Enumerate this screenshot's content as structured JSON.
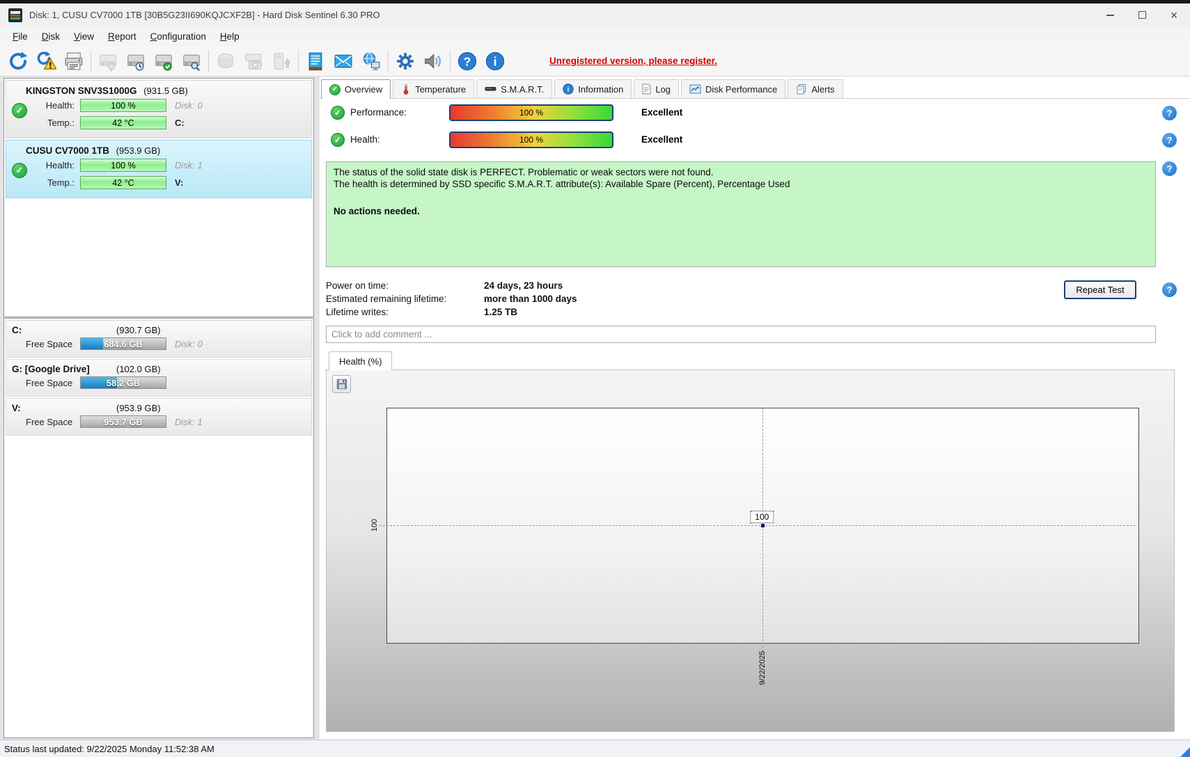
{
  "window": {
    "title": "Disk: 1, CUSU CV7000 1TB [30B5G23II690KQJCXF2B]  -  Hard Disk Sentinel 6.30 PRO",
    "control_icons": [
      "minimize-icon",
      "maximize-icon",
      "close-icon"
    ]
  },
  "menu": {
    "items": [
      "File",
      "Disk",
      "View",
      "Report",
      "Configuration",
      "Help"
    ]
  },
  "toolbar": {
    "icon_names": [
      "refresh-icon",
      "refresh-warning-icon",
      "report-printer-icon",
      "disk-connect-icon",
      "disk-clock-icon",
      "disk-check-icon",
      "disk-search-icon",
      "disk-generic-icon",
      "disk-camera-icon",
      "disk-eject-icon",
      "notes-icon",
      "email-icon",
      "network-icon",
      "settings-gear-icon",
      "sounds-speaker-icon",
      "help-icon",
      "info-icon"
    ],
    "unregistered": "Unregistered version, please register."
  },
  "disks": [
    {
      "name": "KINGSTON SNV3S1000G",
      "size": "(931.5 GB)",
      "health_label": "Health:",
      "health_value": "100 %",
      "disk_label": "Disk: 0",
      "temp_label": "Temp.:",
      "temp_value": "42 °C",
      "drive_letter": "C:"
    },
    {
      "name": "CUSU CV7000 1TB",
      "size": "(953.9 GB)",
      "health_label": "Health:",
      "health_value": "100 %",
      "disk_label": "Disk: 1",
      "temp_label": "Temp.:",
      "temp_value": "42 °C",
      "drive_letter": "V:"
    }
  ],
  "partitions": [
    {
      "name": "C:",
      "size": "(930.7 GB)",
      "free_label": "Free Space",
      "free_value": "684.6 GB",
      "used_pct": 26,
      "disk_label": "Disk: 0"
    },
    {
      "name": "G: [Google Drive]",
      "size": "(102.0 GB)",
      "free_label": "Free Space",
      "free_value": "58.2 GB",
      "used_pct": 43,
      "disk_label": ""
    },
    {
      "name": "V:",
      "size": "(953.9 GB)",
      "free_label": "Free Space",
      "free_value": "953.7 GB",
      "used_pct": 0,
      "disk_label": "Disk: 1"
    }
  ],
  "tabs": [
    {
      "label": "Overview",
      "active": true
    },
    {
      "label": "Temperature",
      "active": false
    },
    {
      "label": "S.M.A.R.T.",
      "active": false
    },
    {
      "label": "Information",
      "active": false
    },
    {
      "label": "Log",
      "active": false
    },
    {
      "label": "Disk Performance",
      "active": false
    },
    {
      "label": "Alerts",
      "active": false
    }
  ],
  "overview": {
    "performance_label": "Performance:",
    "performance_value": "100 %",
    "performance_rating": "Excellent",
    "health_label": "Health:",
    "health_value": "100 %",
    "health_rating": "Excellent",
    "status_line1": "The status of the solid state disk is PERFECT. Problematic or weak sectors were not found.",
    "status_line2": "The health is determined by SSD specific S.M.A.R.T. attribute(s):  Available Spare (Percent), Percentage Used",
    "status_line3": "No actions needed.",
    "power_on_label": "Power on time:",
    "power_on_value": "24 days, 23 hours",
    "remaining_label": "Estimated remaining lifetime:",
    "remaining_value": "more than 1000 days",
    "writes_label": "Lifetime writes:",
    "writes_value": "1.25 TB",
    "repeat_test_label": "Repeat Test",
    "comment_placeholder": "Click to add comment ..."
  },
  "graph": {
    "tab_label": "Health (%)",
    "point_value": "100",
    "y_axis_tick": "100",
    "x_axis_tick": "9/22/2025"
  },
  "chart_data": {
    "type": "line",
    "title": "Health (%)",
    "x": [
      "9/22/2025"
    ],
    "series": [
      {
        "name": "Health",
        "values": [
          100
        ]
      }
    ],
    "ylabel": "Health (%)",
    "grid": "dashed-crosshair-at-point",
    "legend": "none"
  },
  "colors": {
    "health_bar_green": "#8af08a",
    "used_space_blue": "#187cc0",
    "ok_green": "#1f9e38",
    "unregistered_red": "#d40000",
    "selected_disk_cyan": "#c4ebf9",
    "status_box_green": "#c6f6c6",
    "gauge_gradient": [
      "#e63832",
      "#f2d23a",
      "#35d93a"
    ]
  },
  "status_bar": {
    "text": "Status last updated: 9/22/2025 Monday 11:52:38 AM"
  }
}
